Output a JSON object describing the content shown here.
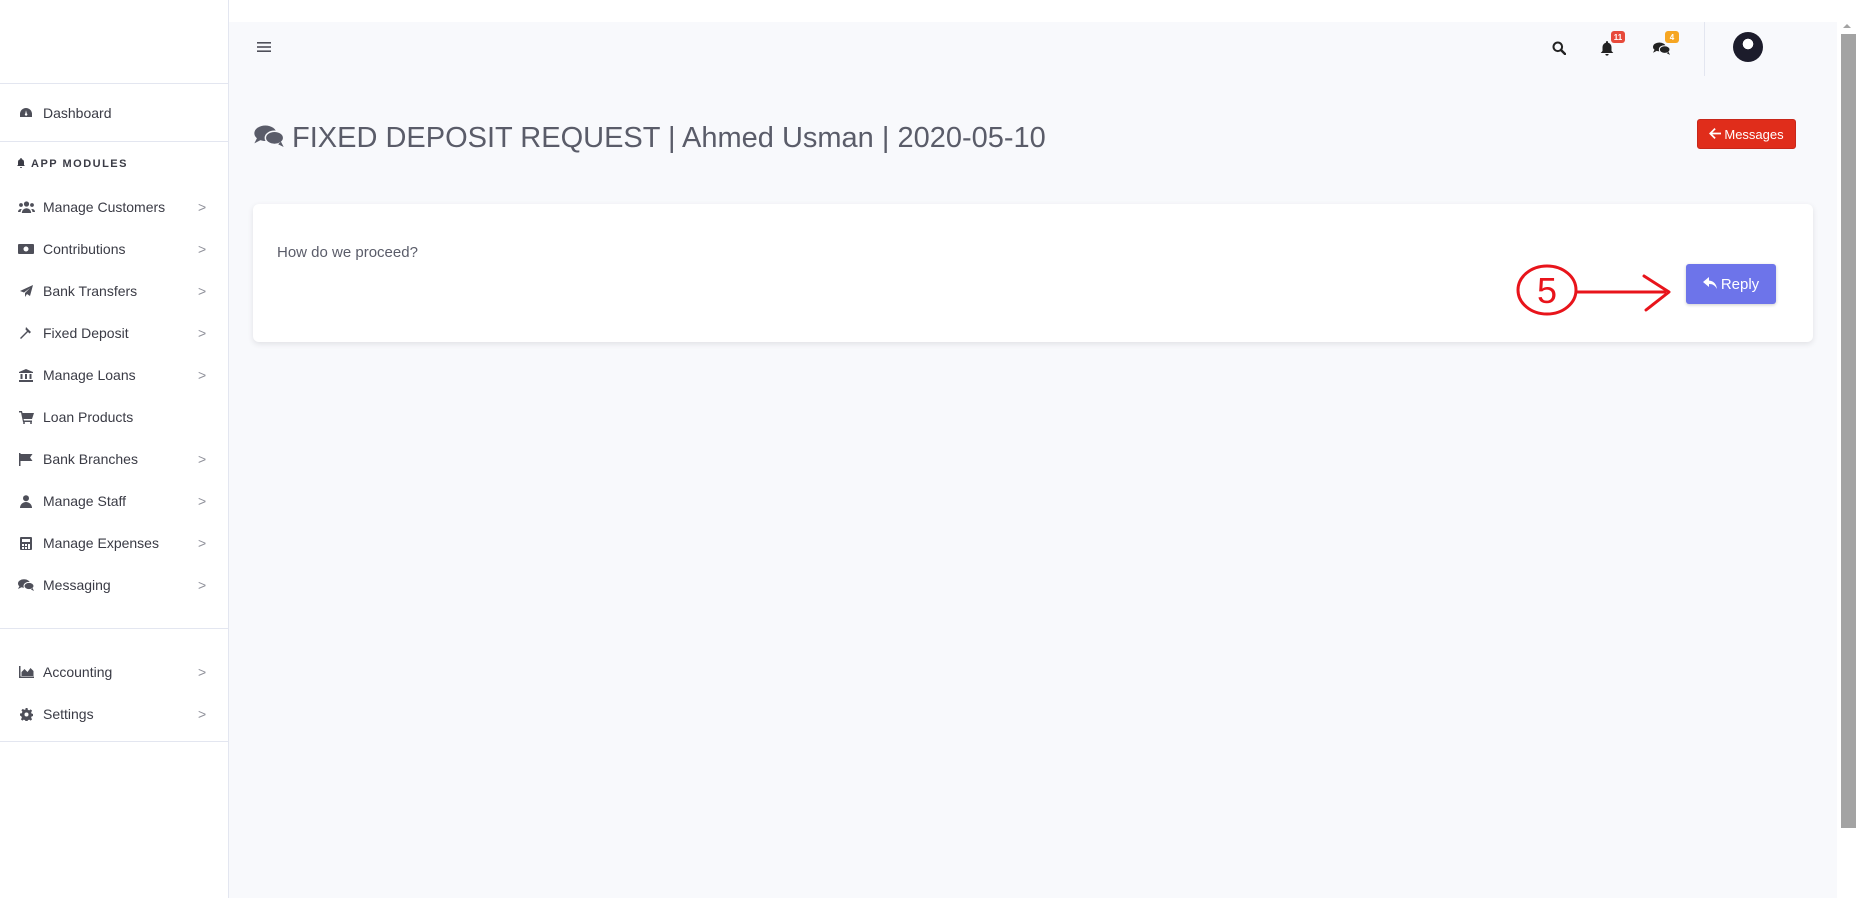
{
  "sidebar": {
    "dashboard": {
      "label": "Dashboard",
      "icon": "tachometer-icon"
    },
    "section_heading": "APP MODULES",
    "items": [
      {
        "label": "Manage Customers",
        "icon": "users-icon",
        "chevron": ">"
      },
      {
        "label": "Contributions",
        "icon": "money-icon",
        "chevron": ">"
      },
      {
        "label": "Bank Transfers",
        "icon": "paper-plane-icon",
        "chevron": ">"
      },
      {
        "label": "Fixed Deposit",
        "icon": "hammer-icon",
        "chevron": ">"
      },
      {
        "label": "Manage Loans",
        "icon": "bank-icon",
        "chevron": ">"
      },
      {
        "label": "Loan Products",
        "icon": "cart-icon",
        "chevron": ""
      },
      {
        "label": "Bank Branches",
        "icon": "flag-icon",
        "chevron": ">"
      },
      {
        "label": "Manage Staff",
        "icon": "user-icon",
        "chevron": ">"
      },
      {
        "label": "Manage Expenses",
        "icon": "calculator-icon",
        "chevron": ">"
      },
      {
        "label": "Messaging",
        "icon": "comments-icon",
        "chevron": ">"
      }
    ],
    "bottom_items": [
      {
        "label": "Accounting",
        "icon": "area-chart-icon",
        "chevron": ">"
      },
      {
        "label": "Settings",
        "icon": "cog-icon",
        "chevron": ">"
      }
    ]
  },
  "topbar": {
    "notifications_badge": "11",
    "messages_badge": "4",
    "hamburger_icon": "bars-icon"
  },
  "page": {
    "title": "FIXED DEPOSIT REQUEST | Ahmed Usman | 2020-05-10",
    "back_button_label": "Messages",
    "message_text": "How do we proceed?",
    "reply_button_label": "Reply",
    "annotation_number": "5"
  },
  "colors": {
    "back_button": "#e02d1b",
    "reply_button": "#6d74ea",
    "notification_badge": "#e74a3b",
    "message_badge": "#f6a623",
    "annotation": "#e8141b"
  }
}
